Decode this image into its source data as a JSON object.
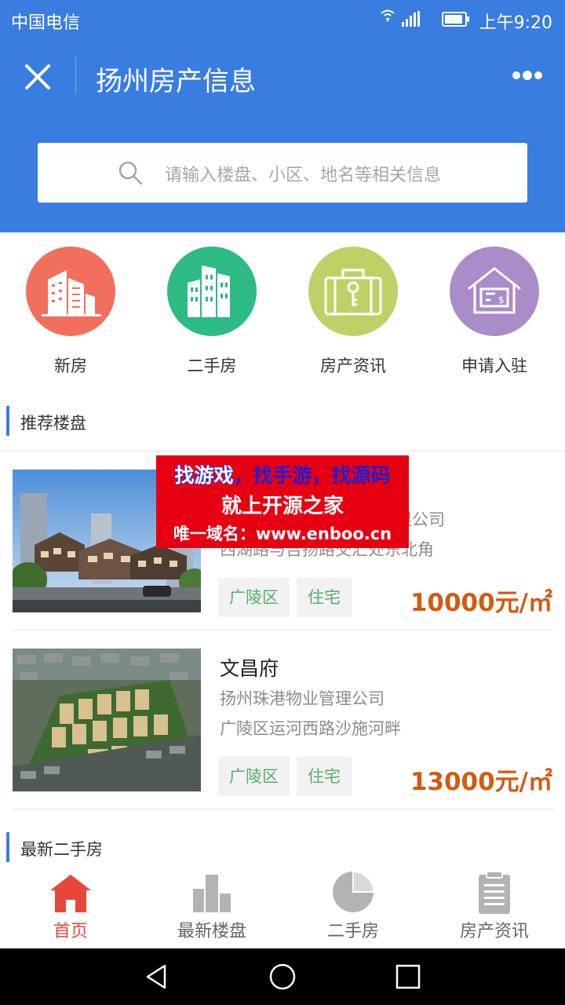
{
  "status_bar": {
    "carrier": "中国电信",
    "network": "4G 2G",
    "time": "上午9:20"
  },
  "header": {
    "title": "扬州房产信息",
    "close_icon": "close-icon",
    "more_icon": "more-dots-icon",
    "background_color": "#3a7de0"
  },
  "search": {
    "placeholder": "请输入楼盘、小区、地名等相关信息",
    "icon": "search-icon"
  },
  "categories": [
    {
      "label": "新房",
      "icon": "buildings-icon",
      "color": "#f26f5e"
    },
    {
      "label": "二手房",
      "icon": "towers-icon",
      "color": "#2dbb84"
    },
    {
      "label": "房产资讯",
      "icon": "briefcase-key-icon",
      "color": "#c1d066"
    },
    {
      "label": "申请入驻",
      "icon": "house-price-icon",
      "color": "#a98cc8"
    }
  ],
  "sections": {
    "recommended": "推荐楼盘",
    "latest_second_hand": "最新二手房"
  },
  "listings": [
    {
      "name": "",
      "company": "限公司",
      "address": "西湖路与吉扬路交汇处东北角",
      "tags": [
        "广陵区",
        "住宅"
      ],
      "price": "10000元/㎡"
    },
    {
      "name": "文昌府",
      "company": "扬州珠港物业管理公司",
      "address": "广陵区运河西路沙施河畔",
      "tags": [
        "广陵区",
        "住宅"
      ],
      "price": "13000元/㎡"
    }
  ],
  "ad_overlay": {
    "line1_a": "找游戏",
    "line1_b": "，找手游，找源码",
    "line2": "就上开源之家",
    "line3": "唯一域名：www.enboo.cn"
  },
  "tabbar": [
    {
      "label": "首页",
      "icon": "home-icon",
      "active": true
    },
    {
      "label": "最新楼盘",
      "icon": "bar-chart-icon",
      "active": false
    },
    {
      "label": "二手房",
      "icon": "pie-chart-icon",
      "active": false
    },
    {
      "label": "房产资讯",
      "icon": "clipboard-icon",
      "active": false
    }
  ],
  "colors": {
    "accent": "#3a7de0",
    "price": "#d35a12",
    "tag_text": "#56b06b",
    "active_tab": "#e8463b"
  }
}
